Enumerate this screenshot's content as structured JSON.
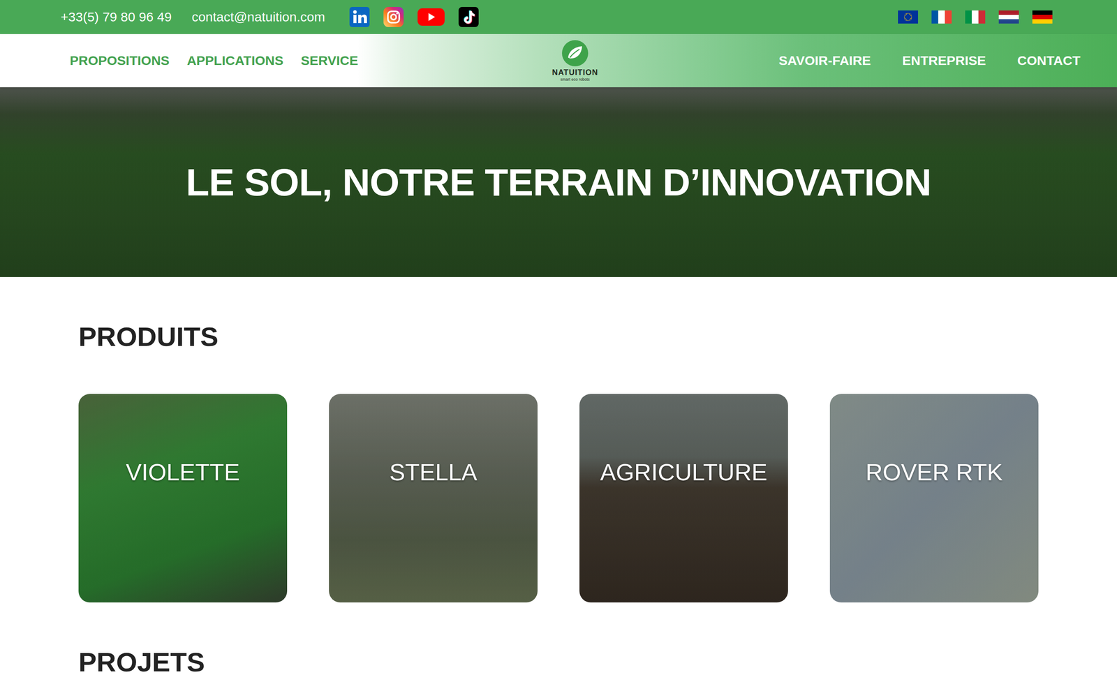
{
  "top_bar": {
    "phone": "+33(5) 79 80 96 49",
    "email": "contact@natuition.com"
  },
  "nav": {
    "left": [
      {
        "label": "PROPOSITIONS"
      },
      {
        "label": "APPLICATIONS"
      },
      {
        "label": "SERVICE"
      }
    ],
    "logo": {
      "name": "NATUITION",
      "tagline": "smart eco robots"
    },
    "right": [
      {
        "label": "SAVOIR-FAIRE"
      },
      {
        "label": "ENTREPRISE"
      },
      {
        "label": "CONTACT"
      }
    ]
  },
  "hero": {
    "title": "LE SOL, NOTRE TERRAIN D’INNOVATION"
  },
  "sections": [
    {
      "title": "PRODUITS",
      "cards": [
        {
          "label": "VIOLETTE"
        },
        {
          "label": "STELLA"
        },
        {
          "label": "AGRICULTURE"
        },
        {
          "label": "ROVER RTK"
        }
      ]
    },
    {
      "title": "PROJETS",
      "cards": []
    }
  ]
}
